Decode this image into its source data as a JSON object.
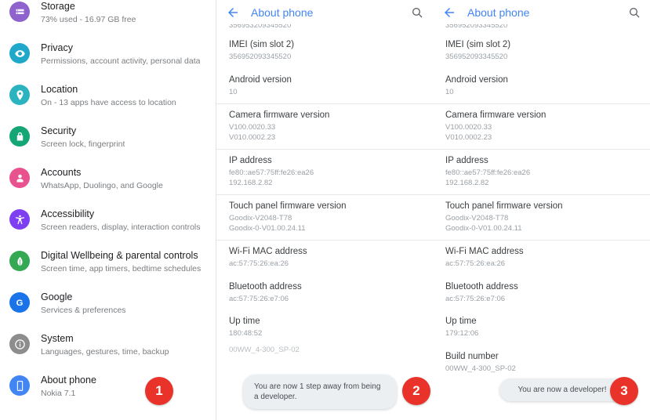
{
  "panel1": {
    "name": "android-settings-list",
    "items": [
      {
        "title": "Storage",
        "subtitle": "73% used - 16.97 GB free",
        "icon": "storage-icon",
        "color": "#8e63ce"
      },
      {
        "title": "Privacy",
        "subtitle": "Permissions, account activity, personal data",
        "icon": "privacy-eye-icon",
        "color": "#1fa8c9"
      },
      {
        "title": "Location",
        "subtitle": "On - 13 apps have access to location",
        "icon": "location-pin-icon",
        "color": "#2bb3c0"
      },
      {
        "title": "Security",
        "subtitle": "Screen lock, fingerprint",
        "icon": "security-lock-icon",
        "color": "#14a674"
      },
      {
        "title": "Accounts",
        "subtitle": "WhatsApp, Duolingo, and Google",
        "icon": "accounts-person-icon",
        "color": "#e8538f"
      },
      {
        "title": "Accessibility",
        "subtitle": "Screen readers, display, interaction controls",
        "icon": "accessibility-icon",
        "color": "#7e3ff2"
      },
      {
        "title": "Digital Wellbeing & parental controls",
        "subtitle": "Screen time, app timers, bedtime schedules",
        "icon": "wellbeing-leaf-icon",
        "color": "#34a853"
      },
      {
        "title": "Google",
        "subtitle": "Services & preferences",
        "icon": "google-g-icon",
        "color": "#1a73e8"
      },
      {
        "title": "System",
        "subtitle": "Languages, gestures, time, backup",
        "icon": "system-info-icon",
        "color": "#8d8d8d"
      },
      {
        "title": "About phone",
        "subtitle": "Nokia 7.1",
        "icon": "phone-icon",
        "color": "#4285f4"
      }
    ]
  },
  "panel2": {
    "name": "about-phone-screen-step2",
    "header": {
      "title": "About phone",
      "back_icon": "arrow-back-icon",
      "search_icon": "search-icon"
    },
    "cut_top_value": "356953209345520",
    "items": [
      {
        "label": "IMEI (sim slot 2)",
        "value": "356952093345520",
        "sep": false
      },
      {
        "label": "Android version",
        "value": "10",
        "sep": false
      },
      {
        "label": "Camera firmware version",
        "value": "V100.0020.33\nV010.0002.23",
        "sep": true
      },
      {
        "label": "IP address",
        "value": "fe80::ae57:75ff:fe26:ea26\n192.168.2.82",
        "sep": true
      },
      {
        "label": "Touch panel firmware version",
        "value": "Goodix-V2048-T78\nGoodix-0-V01.00.24.11",
        "sep": true
      },
      {
        "label": "Wi-Fi MAC address",
        "value": "ac:57:75:26:ea:26",
        "sep": true
      },
      {
        "label": "Bluetooth address",
        "value": "ac:57:75:26:e7:06",
        "sep": false
      },
      {
        "label": "Up time",
        "value": "180:48:52",
        "sep": false
      }
    ],
    "clipped_bottom": "00WW_4-300_SP-02",
    "toast": "You are now 1 step away from being a developer."
  },
  "panel3": {
    "name": "about-phone-screen-step3",
    "header": {
      "title": "About phone",
      "back_icon": "arrow-back-icon",
      "search_icon": "search-icon"
    },
    "cut_top_value": "356952093345520",
    "items": [
      {
        "label": "IMEI (sim slot 2)",
        "value": "356952093345520",
        "sep": false
      },
      {
        "label": "Android version",
        "value": "10",
        "sep": false
      },
      {
        "label": "Camera firmware version",
        "value": "V100.0020.33\nV010.0002.23",
        "sep": true
      },
      {
        "label": "IP address",
        "value": "fe80::ae57:75ff:fe26:ea26\n192.168.2.82",
        "sep": true
      },
      {
        "label": "Touch panel firmware version",
        "value": "Goodix-V2048-T78\nGoodix-0-V01.00.24.11",
        "sep": true
      },
      {
        "label": "Wi-Fi MAC address",
        "value": "ac:57:75:26:ea:26",
        "sep": true
      },
      {
        "label": "Bluetooth address",
        "value": "ac:57:75:26:e7:06",
        "sep": false
      },
      {
        "label": "Up time",
        "value": "179:12:06",
        "sep": false
      },
      {
        "label": "Build number",
        "value": "00WW_4-300_SP-02",
        "sep": false
      }
    ],
    "toast": "You are now a developer!"
  },
  "badges": [
    {
      "label": "1",
      "name": "step-badge-1"
    },
    {
      "label": "2",
      "name": "step-badge-2"
    },
    {
      "label": "3",
      "name": "step-badge-3"
    }
  ],
  "colors": {
    "accent_blue": "#4285f4",
    "badge_red": "#e8322a",
    "text_primary": "#202124",
    "text_secondary": "#7a7d80",
    "toast_bg": "#eceff1"
  }
}
